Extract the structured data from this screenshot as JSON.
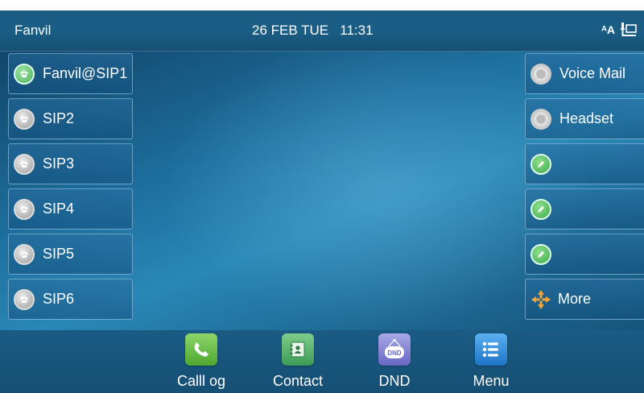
{
  "status_bar": {
    "brand": "Fanvil",
    "date_time": "26 FEB TUE   11:31",
    "icons": [
      "font-size-icon",
      "network-icon"
    ]
  },
  "line_keys": [
    {
      "label": "Fanvil@SIP1",
      "icon": "phone-icon",
      "status": "registered",
      "color": "#4fb05a"
    },
    {
      "label": "SIP2",
      "icon": "phone-icon",
      "status": "idle",
      "color": "#9a9a9a"
    },
    {
      "label": "SIP3",
      "icon": "phone-icon",
      "status": "idle",
      "color": "#9a9a9a"
    },
    {
      "label": "SIP4",
      "icon": "phone-icon",
      "status": "idle",
      "color": "#9a9a9a"
    },
    {
      "label": "SIP5",
      "icon": "phone-icon",
      "status": "idle",
      "color": "#9a9a9a"
    },
    {
      "label": "SIP6",
      "icon": "phone-icon",
      "status": "idle",
      "color": "#9a9a9a"
    }
  ],
  "function_keys": [
    {
      "label": "Voice Mail",
      "icon": "voicemail-icon"
    },
    {
      "label": "Headset",
      "icon": "headset-icon"
    },
    {
      "label": "",
      "icon": "edit-icon"
    },
    {
      "label": "",
      "icon": "edit-icon"
    },
    {
      "label": "",
      "icon": "edit-icon"
    },
    {
      "label": "More",
      "icon": "more-arrows-icon"
    }
  ],
  "dock": [
    {
      "label": "Calll og",
      "icon": "call-log-icon"
    },
    {
      "label": "Contact",
      "icon": "contact-icon"
    },
    {
      "label": "DND",
      "icon": "dnd-icon",
      "icon_text": "DND"
    },
    {
      "label": "Menu",
      "icon": "menu-icon"
    }
  ]
}
